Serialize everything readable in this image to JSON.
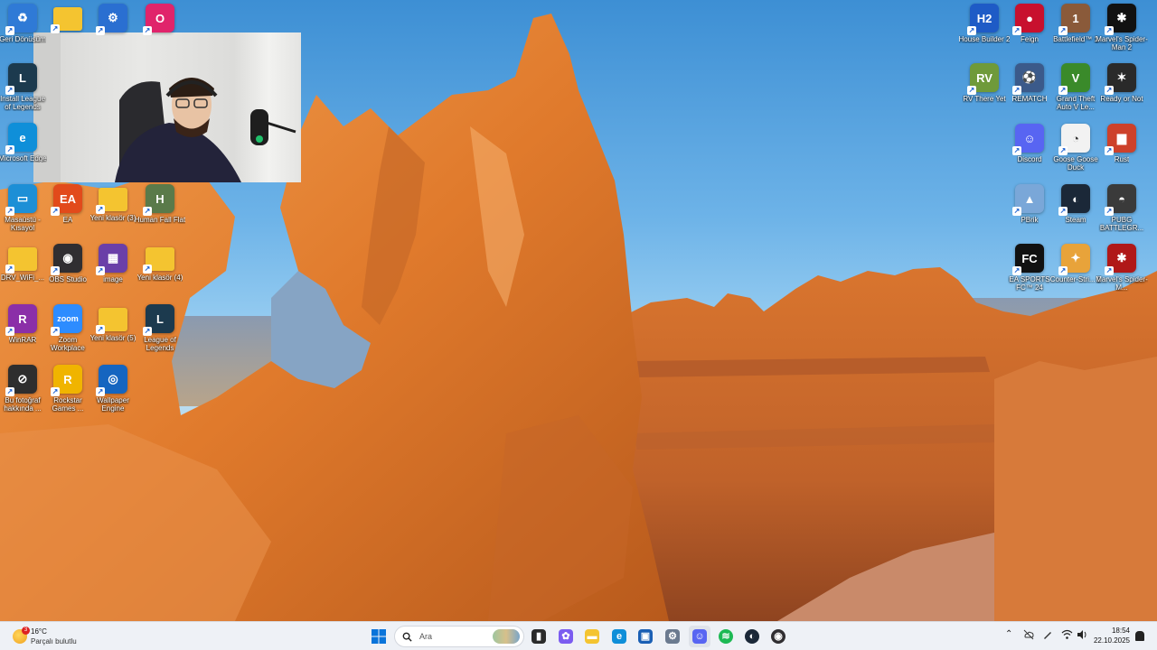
{
  "desktop_left": [
    {
      "label": "Geri Dönüşüm",
      "icon": "recycle-bin-icon",
      "color": "#2f7ad6"
    },
    {
      "label": "",
      "icon": "folder-icon",
      "color": "#f4c430"
    },
    {
      "label": "",
      "icon": "settings-app-icon",
      "color": "#2a6fd1"
    },
    {
      "label": "",
      "icon": "opera-icon",
      "color": "#e0246b"
    },
    {
      "label": "Install League of Legends",
      "icon": "league-icon",
      "color": "#1c3a4e"
    },
    {
      "label": "Microsoft Edge",
      "icon": "edge-icon",
      "color": "#0f8fd9"
    },
    {
      "label": "Masaüstü - Kısayol",
      "icon": "desktop-shortcut-icon",
      "color": "#1d8fd6"
    },
    {
      "label": "EA",
      "icon": "ea-icon",
      "color": "#e24a1b"
    },
    {
      "label": "Yeni klasör (3)",
      "icon": "folder-icon",
      "color": "#f4c430"
    },
    {
      "label": "Human Fall Flat",
      "icon": "human-fall-flat-icon",
      "color": "#5a7a4a"
    },
    {
      "label": "DRV_WiFi_...",
      "icon": "folder-icon",
      "color": "#f4c430"
    },
    {
      "label": "OBS Studio",
      "icon": "obs-icon",
      "color": "#302e31"
    },
    {
      "label": "image",
      "icon": "image-file-icon",
      "color": "#6a3fa8"
    },
    {
      "label": "Yeni klasör (4)",
      "icon": "folder-icon",
      "color": "#f4c430"
    },
    {
      "label": "WinRAR",
      "icon": "winrar-icon",
      "color": "#8b2fa8"
    },
    {
      "label": "Zoom Workplace",
      "icon": "zoom-icon",
      "color": "#2d8cff"
    },
    {
      "label": "Yeni klasör (5)",
      "icon": "folder-icon",
      "color": "#f4c430"
    },
    {
      "label": "League of Legends",
      "icon": "league-icon",
      "color": "#1c3a4e"
    },
    {
      "label": "Bu fotoğraf hakkında ...",
      "icon": "about-photo-icon",
      "color": "#2e2e2e"
    },
    {
      "label": "Rockstar Games ...",
      "icon": "rockstar-icon",
      "color": "#f0b400"
    },
    {
      "label": "Wallpaper Engine",
      "icon": "wallpaper-engine-icon",
      "color": "#1565c0"
    }
  ],
  "desktop_right": [
    {
      "label": "House Builder 2",
      "icon": "house-builder-icon",
      "color": "#1e5bc6"
    },
    {
      "label": "Feign",
      "icon": "feign-icon",
      "color": "#c8102e"
    },
    {
      "label": "Battlefield™ 1",
      "icon": "battlefield-icon",
      "color": "#8a5a3a"
    },
    {
      "label": "Marvel's Spider-Man 2",
      "icon": "spiderman-icon",
      "color": "#111111"
    },
    {
      "label": "RV There Yet",
      "icon": "rv-there-yet-icon",
      "color": "#6f9a3a"
    },
    {
      "label": "REMATCH",
      "icon": "rematch-icon",
      "color": "#3b5a8a"
    },
    {
      "label": "Grand Theft Auto V Le...",
      "icon": "gta-icon",
      "color": "#3a8a2a"
    },
    {
      "label": "Ready or Not",
      "icon": "ready-or-not-icon",
      "color": "#2a2a2a"
    },
    {
      "label": "Discord",
      "icon": "discord-icon",
      "color": "#5865f2"
    },
    {
      "label": "Goose Goose Duck",
      "icon": "goose-goose-duck-icon",
      "color": "#f2f2f2"
    },
    {
      "label": "Rust",
      "icon": "rust-icon",
      "color": "#cd412b"
    },
    {
      "label": "PBrik",
      "icon": "pbrik-icon",
      "color": "#7aa7d8"
    },
    {
      "label": "Steam",
      "icon": "steam-icon",
      "color": "#1b2838"
    },
    {
      "label": "PUBG BATTLEGR...",
      "icon": "pubg-icon",
      "color": "#3a3a3a"
    },
    {
      "label": "EA SPORTS FC™ 24",
      "icon": "ea-fc-icon",
      "color": "#111111"
    },
    {
      "label": "Counter-Stri... 2",
      "icon": "counter-strike-icon",
      "color": "#e8a33a"
    },
    {
      "label": "Marvel's Spider-M...",
      "icon": "spiderman-icon",
      "color": "#b01818"
    }
  ],
  "taskbar": {
    "weather": {
      "temp": "16°C",
      "desc": "Parçalı bulutlu",
      "badge": "3"
    },
    "search_placeholder": "Ara",
    "apps": [
      {
        "name": "start-button",
        "icon": "windows-logo-icon",
        "color": "#0078d4"
      },
      {
        "name": "task-view",
        "icon": "task-view-icon",
        "color": "#2b2b2b"
      },
      {
        "name": "copilot",
        "icon": "copilot-icon",
        "color": "#7b5cf0"
      },
      {
        "name": "file-explorer",
        "icon": "folder-icon",
        "color": "#f4c430"
      },
      {
        "name": "edge",
        "icon": "edge-icon",
        "color": "#0f8fd9"
      },
      {
        "name": "store",
        "icon": "store-icon",
        "color": "#1a5fb4"
      },
      {
        "name": "settings",
        "icon": "gear-icon",
        "color": "#6b7a8f"
      },
      {
        "name": "discord",
        "icon": "discord-icon",
        "color": "#5865f2"
      },
      {
        "name": "spotify",
        "icon": "spotify-icon",
        "color": "#1db954"
      },
      {
        "name": "steam",
        "icon": "steam-icon",
        "color": "#1b2838"
      },
      {
        "name": "obs",
        "icon": "obs-icon",
        "color": "#302e31"
      }
    ],
    "clock_time": "18:54",
    "clock_date": "22.10.2025"
  }
}
